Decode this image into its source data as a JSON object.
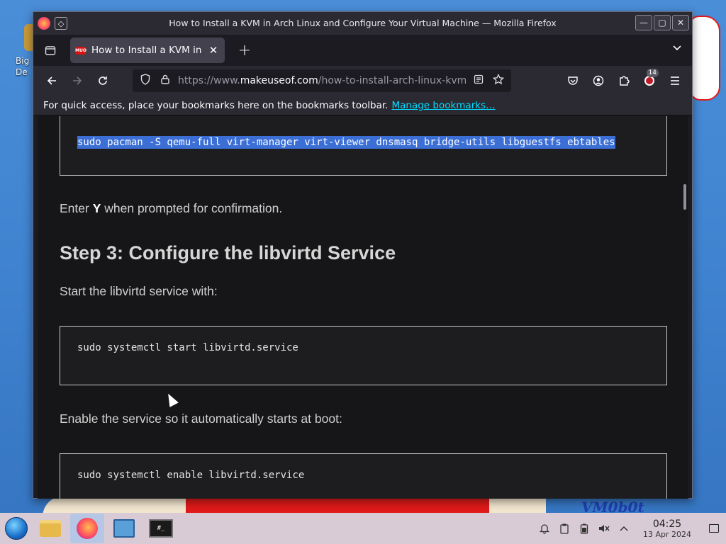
{
  "desktop": {
    "icon_label": "Big\nDe",
    "wall_text": "VM0b0t"
  },
  "window": {
    "title": "How to Install a KVM in Arch Linux and Configure Your Virtual Machine — Mozilla Firefox",
    "controls": {
      "minimize": "—",
      "maximize": "▢",
      "close": "✕"
    }
  },
  "tabs": [
    {
      "title": "How to Install a KVM in Arch Linux and Configure Your Virtual Machine",
      "favicon": "MUO"
    }
  ],
  "navbar": {
    "url_prefix": "https://www.",
    "url_host": "makeuseof.com",
    "url_path": "/how-to-install-arch-linux-kvm-",
    "extension_badge": "14"
  },
  "bookmarks_bar": {
    "text": "For quick access, place your bookmarks here on the bookmarks toolbar.",
    "link": "Manage bookmarks…"
  },
  "article": {
    "code1": "sudo pacman -S qemu-full virt-manager virt-viewer dnsmasq bridge-utils libguestfs ebtables",
    "p1_pre": "Enter ",
    "p1_bold": "Y",
    "p1_post": " when prompted for confirmation.",
    "heading": "Step 3: Configure the libvirtd Service",
    "p2": "Start the libvirtd service with:",
    "code2": "sudo systemctl start libvirtd.service",
    "p3": "Enable the service so it automatically starts at boot:",
    "code3": "sudo systemctl enable libvirtd.service"
  },
  "taskbar": {
    "apps": [
      "file-manager",
      "firefox",
      "system-monitor",
      "terminal"
    ],
    "terminal_label": "#_",
    "time": "04:25",
    "date": "13 Apr 2024"
  }
}
